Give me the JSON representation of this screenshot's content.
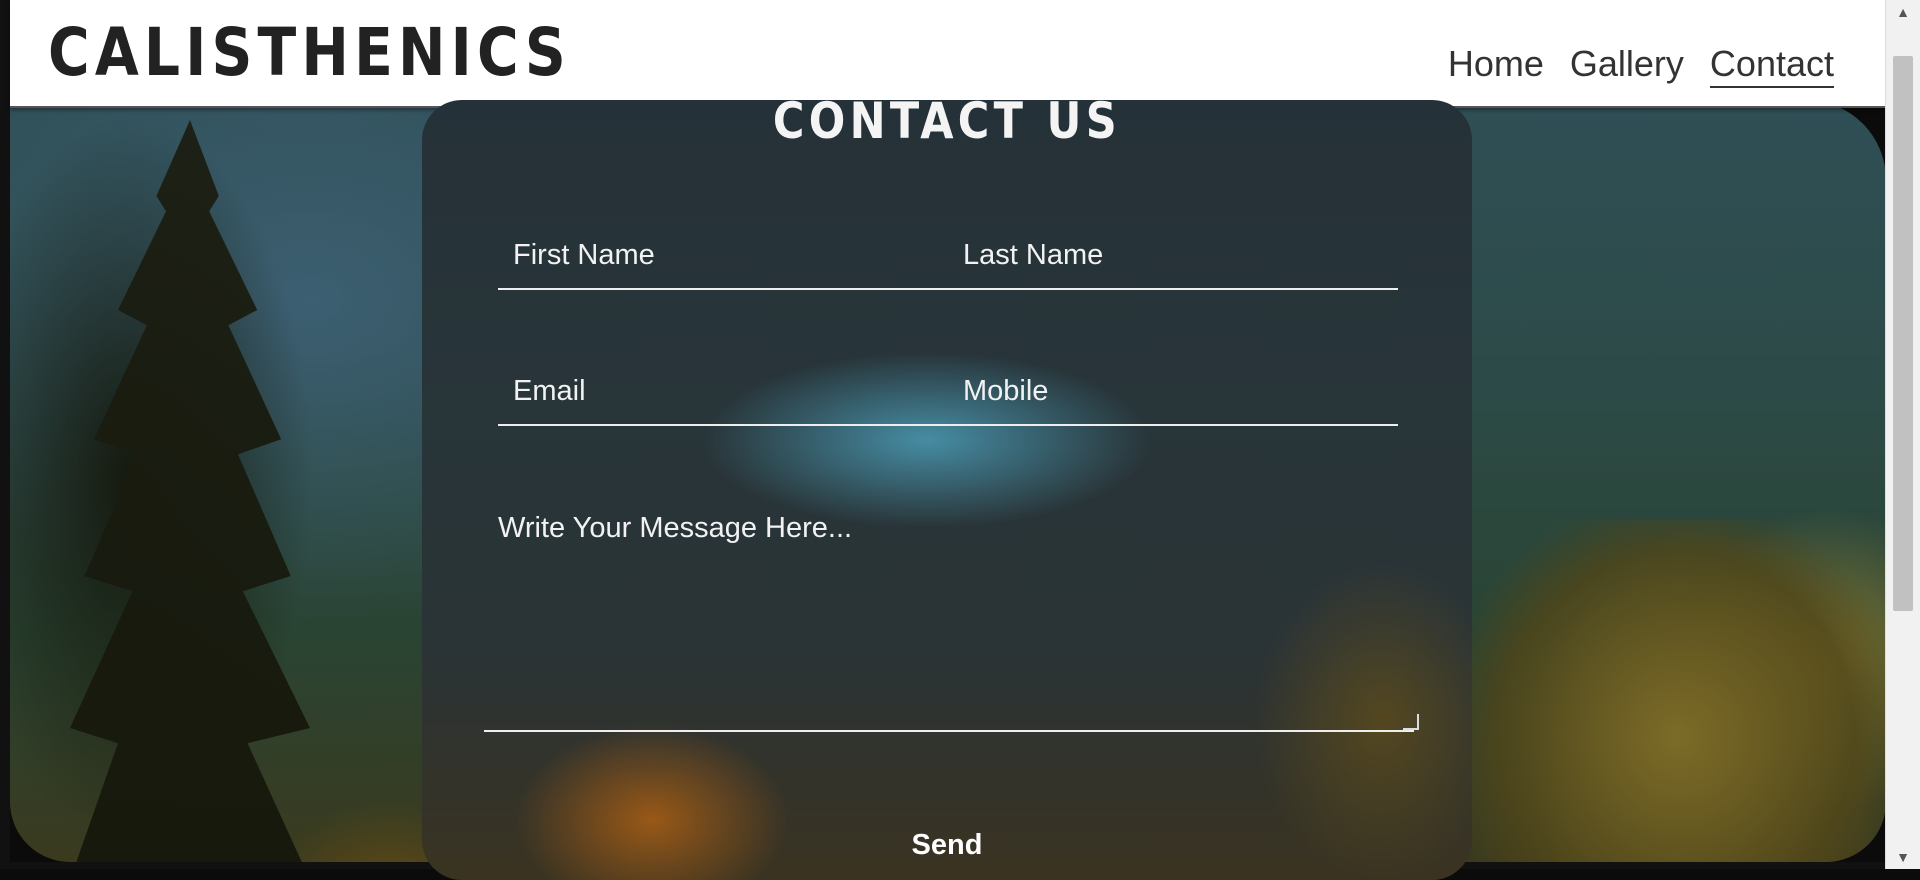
{
  "header": {
    "logo": "CALISTHENICS",
    "nav": [
      {
        "label": "Home",
        "active": false
      },
      {
        "label": "Gallery",
        "active": false
      },
      {
        "label": "Contact",
        "active": true
      }
    ]
  },
  "contact": {
    "title": "CONTACT US",
    "first_name_placeholder": "First Name",
    "last_name_placeholder": "Last Name",
    "email_placeholder": "Email",
    "mobile_placeholder": "Mobile",
    "message_placeholder": "Write Your Message Here...",
    "send_label": "Send"
  },
  "icons": {
    "scroll_up": "triangle-up-icon",
    "scroll_down": "triangle-down-icon"
  },
  "colors": {
    "header_bg": "#ffffff",
    "logo": "#222222",
    "card_text": "#ffffff"
  }
}
